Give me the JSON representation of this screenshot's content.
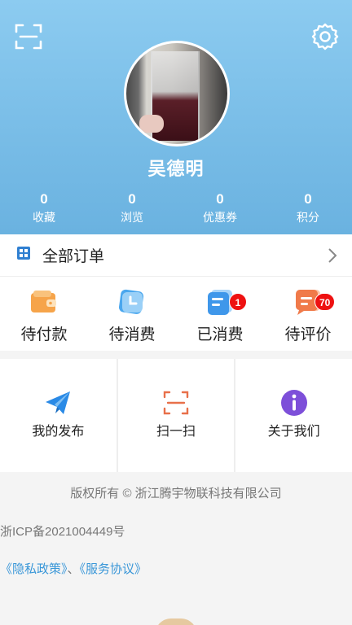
{
  "user": {
    "name": "吴德明"
  },
  "stats": [
    {
      "value": "0",
      "label": "收藏"
    },
    {
      "value": "0",
      "label": "浏览"
    },
    {
      "value": "0",
      "label": "优惠券"
    },
    {
      "value": "0",
      "label": "积分"
    }
  ],
  "orders": {
    "title": "全部订单",
    "items": [
      {
        "label": "待付款",
        "icon": "wallet-icon"
      },
      {
        "label": "待消费",
        "icon": "clock-icon"
      },
      {
        "label": "已消费",
        "icon": "document-icon",
        "badge": "1"
      },
      {
        "label": "待评价",
        "icon": "comment-icon",
        "badge": "70"
      }
    ]
  },
  "tools": [
    {
      "label": "我的发布",
      "icon": "paper-plane-icon"
    },
    {
      "label": "扫一扫",
      "icon": "scan-icon"
    },
    {
      "label": "关于我们",
      "icon": "info-icon"
    }
  ],
  "footer": {
    "copyright": "版权所有 © 浙江腾宇物联科技有限公司",
    "icp": "浙ICP备2021004449号",
    "privacy": "《隐私政策》",
    "separator": "、",
    "service": "《服务协议》"
  },
  "colors": {
    "header": "#7fc0ea",
    "link": "#3a97d8",
    "badge": "#e11111"
  }
}
